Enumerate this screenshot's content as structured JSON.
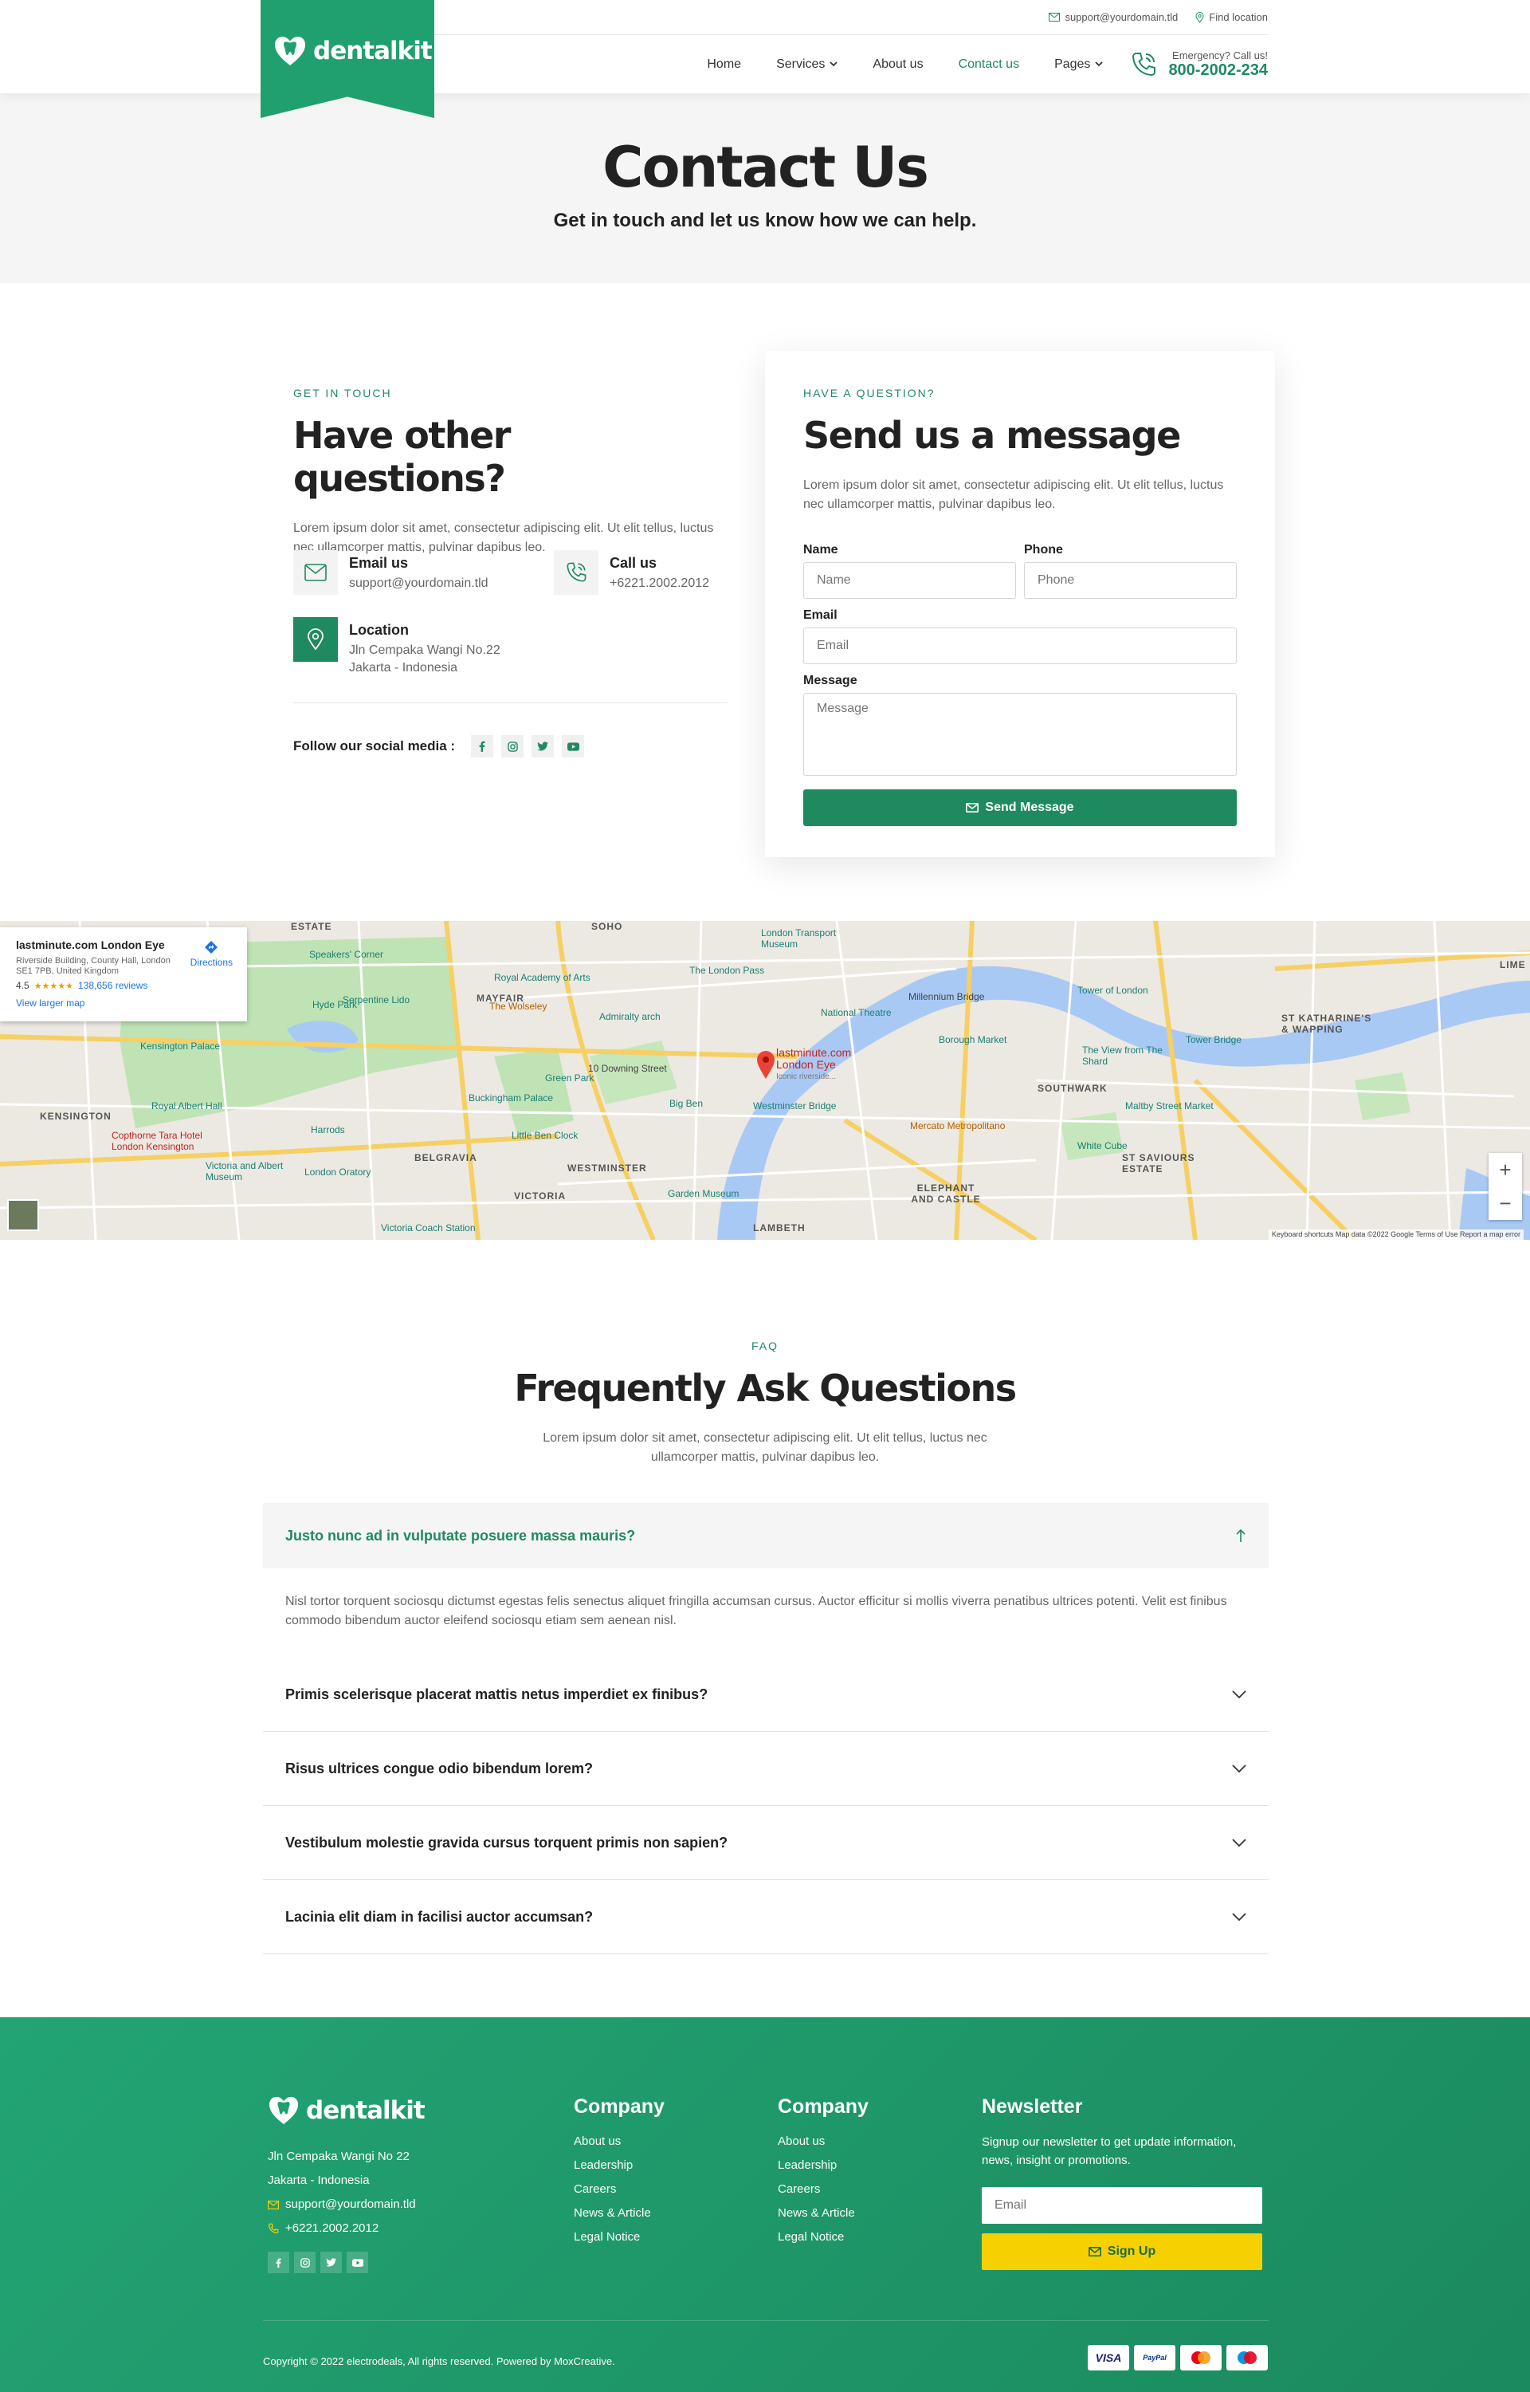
{
  "brand": {
    "name": "dentalkit",
    "accent": "#1f8a60",
    "logo_green": "#21a06f"
  },
  "topbar": {
    "email": "support@yourdomain.tld",
    "location": "Find location"
  },
  "nav": {
    "items": [
      {
        "label": "Home"
      },
      {
        "label": "Services"
      },
      {
        "label": "About us"
      },
      {
        "label": "Contact us"
      },
      {
        "label": "Pages"
      }
    ],
    "emergency_label": "Emergency? Call us!",
    "emergency_phone": "800-2002-234"
  },
  "hero": {
    "title": "Contact Us",
    "subtitle": "Get in touch and let us know how we can help."
  },
  "get_in_touch": {
    "eyebrow": "GET IN TOUCH",
    "title": "Have other questions?",
    "text": "Lorem ipsum dolor sit amet, consectetur adipiscing elit. Ut elit tellus, luctus nec ullamcorper mattis, pulvinar dapibus leo.",
    "email_title": "Email us",
    "email_value": "support@yourdomain.tld",
    "call_title": "Call us",
    "call_value": "+6221.2002.2012",
    "location_title": "Location",
    "location_line1": "Jln Cempaka Wangi No.22",
    "location_line2": "Jakarta - Indonesia",
    "social_label": "Follow our social media :"
  },
  "message_form": {
    "eyebrow": "HAVE A QUESTION?",
    "title": "Send us a message",
    "text": "Lorem ipsum dolor sit amet, consectetur adipiscing elit. Ut elit tellus, luctus nec ullamcorper mattis, pulvinar dapibus leo.",
    "name_label": "Name",
    "name_placeholder": "Name",
    "phone_label": "Phone",
    "phone_placeholder": "Phone",
    "email_label": "Email",
    "email_placeholder": "Email",
    "message_label": "Message",
    "message_placeholder": "Message",
    "submit_label": "Send Message"
  },
  "map": {
    "place_title": "lastminute.com London Eye",
    "place_address": "Riverside Building, County Hall, London SE1 7PB, United Kingdom",
    "rating": "4.5",
    "stars": "★★★★★",
    "reviews": "138,656 reviews",
    "view_larger": "View larger map",
    "directions": "Directions",
    "pin_label_1": "lastminute.com",
    "pin_label_2": "London Eye",
    "pin_label_3": "Iconic riverside...",
    "areas": [
      "SOHO",
      "MAYFAIR",
      "KENSINGTON",
      "BELGRAVIA",
      "WESTMINSTER",
      "VICTORIA",
      "LAMBETH",
      "SOUTHWARK",
      "ELEPHANT AND CASTLE",
      "ST SAVIOURS ESTATE",
      "ST KATHARINE'S & WAPPING",
      "ESTATE",
      "LIME"
    ],
    "pois": [
      "Hyde Park",
      "Green Park",
      "Buckingham Palace",
      "Big Ben",
      "Westminster Bridge",
      "The London Pass",
      "National Theatre",
      "Borough Market",
      "Tower Bridge",
      "Tower of London",
      "The View from The Shard",
      "Kensington Palace",
      "Royal Albert Hall",
      "Harrods",
      "London Oratory",
      "Little Ben Clock",
      "Garden Museum",
      "Victoria Coach Station",
      "Copthorne Tara Hotel London Kensington",
      "Victoria and Albert Museum",
      "Royal Academy of Arts",
      "The Wolseley",
      "Admiralty arch",
      "10 Downing Street",
      "Millennium Bridge",
      "Mercato Metropolitano",
      "White Cube",
      "Maltby Street Market",
      "London Transport Museum",
      "Serpentine Lido",
      "Speakers' Corner"
    ],
    "credits": "Keyboard shortcuts   Map data ©2022 Google   Terms of Use   Report a map error",
    "zoom_in": "+",
    "zoom_out": "−"
  },
  "faq": {
    "eyebrow": "FAQ",
    "title": "Frequently Ask Questions",
    "text": "Lorem ipsum dolor sit amet, consectetur adipiscing elit. Ut elit tellus, luctus nec ullamcorper mattis, pulvinar dapibus leo.",
    "items": [
      {
        "q": "Justo nunc ad in vulputate posuere massa mauris?",
        "a": "Nisl tortor torquent sociosqu dictumst egestas felis senectus aliquet fringilla accumsan cursus. Auctor efficitur si mollis viverra penatibus ultrices potenti. Velit est finibus commodo bibendum auctor eleifend sociosqu etiam sem aenean nisl."
      },
      {
        "q": "Primis scelerisque placerat mattis netus imperdiet ex finibus?"
      },
      {
        "q": "Risus ultrices congue odio bibendum lorem?"
      },
      {
        "q": "Vestibulum molestie gravida cursus torquent primis non sapien?"
      },
      {
        "q": "Lacinia elit diam in facilisi auctor accumsan?"
      }
    ]
  },
  "footer": {
    "address1": "Jln Cempaka Wangi No 22",
    "address2": "Jakarta - Indonesia",
    "email": "support@yourdomain.tld",
    "phone": "+6221.2002.2012",
    "col1": {
      "title": "Company",
      "links": [
        "About us",
        "Leadership",
        "Careers",
        "News & Article",
        "Legal Notice"
      ]
    },
    "col2": {
      "title": "Company",
      "links": [
        "About us",
        "Leadership",
        "Careers",
        "News & Article",
        "Legal Notice"
      ]
    },
    "newsletter": {
      "title": "Newsletter",
      "text": "Signup our newsletter to get update information, news, insight or promotions.",
      "placeholder": "Email",
      "button": "Sign Up"
    },
    "copyright": "Copyright © 2022 electrodeals, All rights reserved. Powered by MoxCreative.",
    "payments": [
      "VISA",
      "PayPal",
      "Mastercard",
      "Maestro"
    ]
  }
}
